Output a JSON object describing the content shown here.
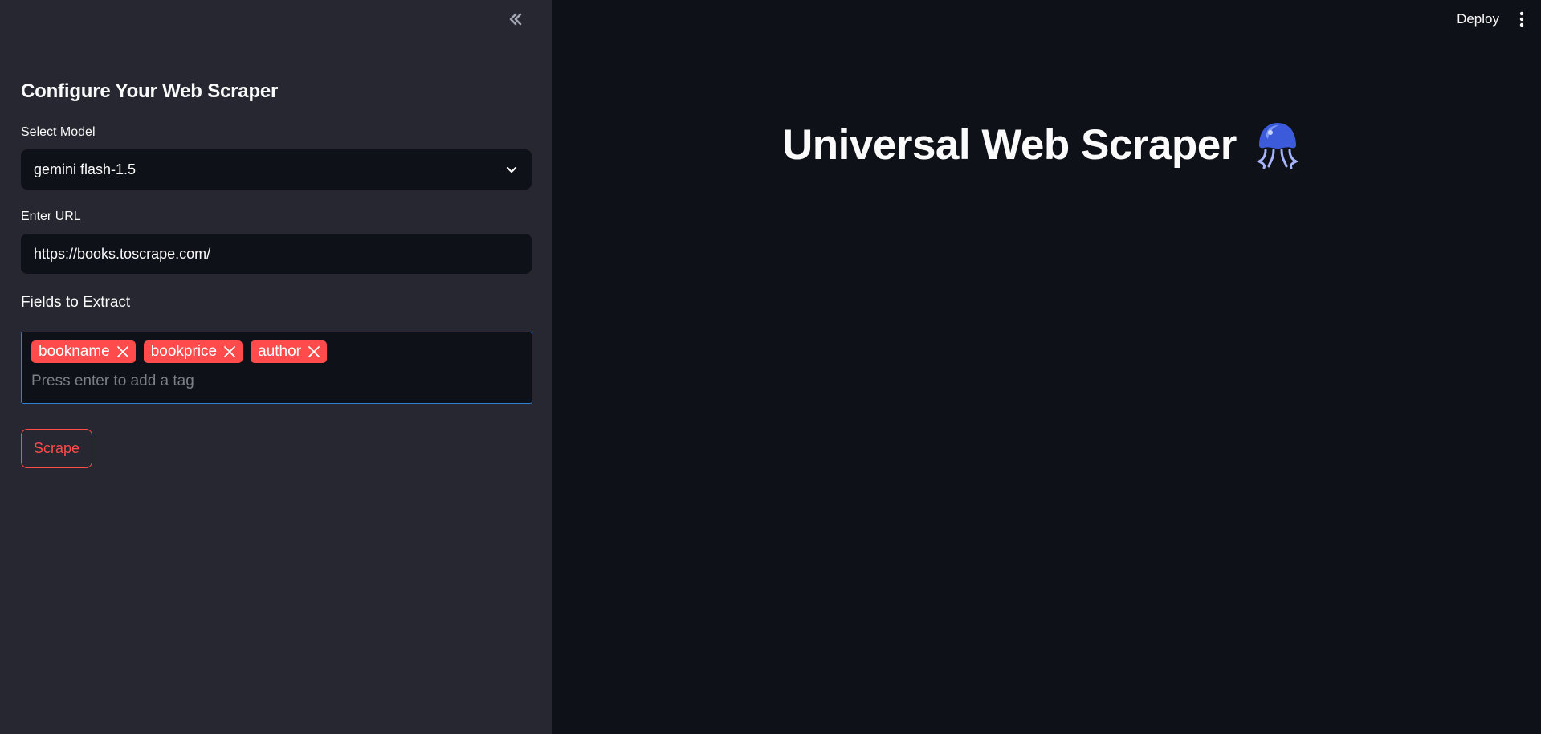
{
  "sidebar": {
    "title": "Configure Your Web Scraper",
    "model_label": "Select Model",
    "model_value": "gemini flash-1.5",
    "url_label": "Enter URL",
    "url_value": "https://books.toscrape.com/",
    "fields_label": "Fields to Extract",
    "tags": [
      "bookname",
      "bookprice",
      "author"
    ],
    "tag_placeholder": "Press enter to add a tag",
    "scrape_label": "Scrape"
  },
  "header": {
    "deploy_label": "Deploy"
  },
  "main": {
    "title": "Universal Web Scraper"
  },
  "icons": {
    "collapse": "double-chevron-left-icon",
    "select_arrow": "chevron-down-icon",
    "tag_remove": "close-icon",
    "menu": "kebab-menu-icon",
    "title_emoji": "jellyfish-icon"
  },
  "colors": {
    "sidebar_bg": "#262730",
    "main_bg": "#0e1117",
    "accent": "#ff4b4b",
    "focus_border": "#2f7fd3"
  }
}
